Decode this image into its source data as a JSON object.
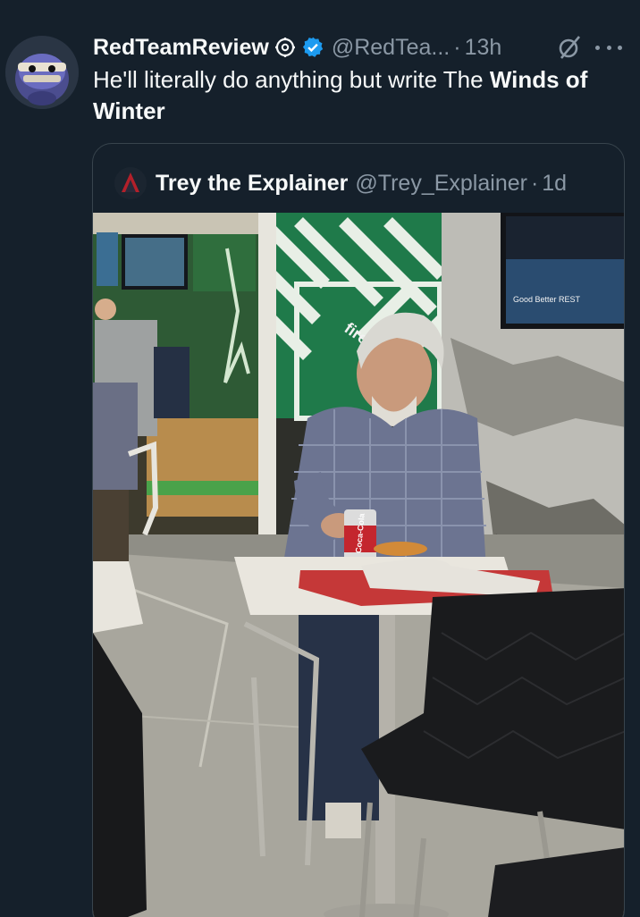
{
  "tweet": {
    "display_name": "RedTeamReview",
    "handle": "@RedTea...",
    "separator": "·",
    "time": "13h",
    "text_part1": "He'll literally do anything but write The ",
    "text_bold": "Winds of Winter",
    "badges": [
      "settings-gear-badge",
      "verified-badge"
    ],
    "verified_color": "#1d9bf0"
  },
  "quote": {
    "display_name": "Trey the Explainer",
    "handle": "@Trey_Explainer",
    "separator": "·",
    "time": "1d",
    "photo": {
      "can_brand": "Coca-Cola",
      "wall_sign": "fire",
      "tv_text": "Good Better REST"
    }
  },
  "colors": {
    "background": "#15202b",
    "text": "#f7f9f9",
    "muted": "#8b98a5",
    "border": "#38444d"
  }
}
